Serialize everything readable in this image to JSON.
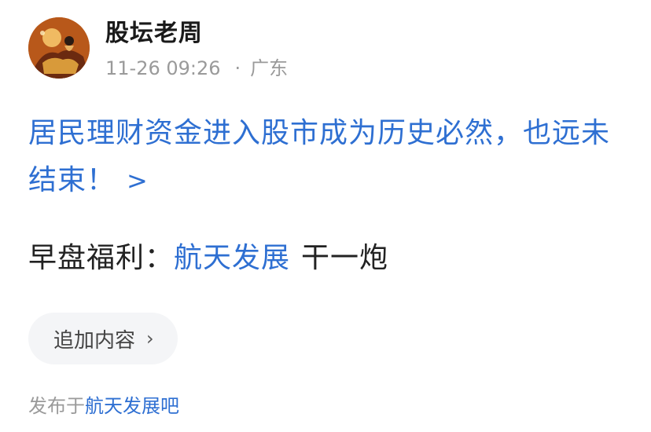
{
  "author": {
    "name": "股坛老周",
    "avatar_icon": "avatar-image",
    "date": "11-26 09:26",
    "separator": "·",
    "location": "广东"
  },
  "post": {
    "title": "居民理财资金进入股市成为历史必然，也远未结束！",
    "title_chevron": ">",
    "body_prefix": "早盘福利：",
    "body_link": "航天发展",
    "body_suffix": "干一炮"
  },
  "actions": {
    "add_content_label": "追加内容",
    "add_content_chevron": "›"
  },
  "footer": {
    "prefix": "发布于",
    "forum": "航天发展吧"
  },
  "colors": {
    "link": "#2e6fd2",
    "meta": "#9a9a9a",
    "button_bg": "#f4f5f7"
  }
}
